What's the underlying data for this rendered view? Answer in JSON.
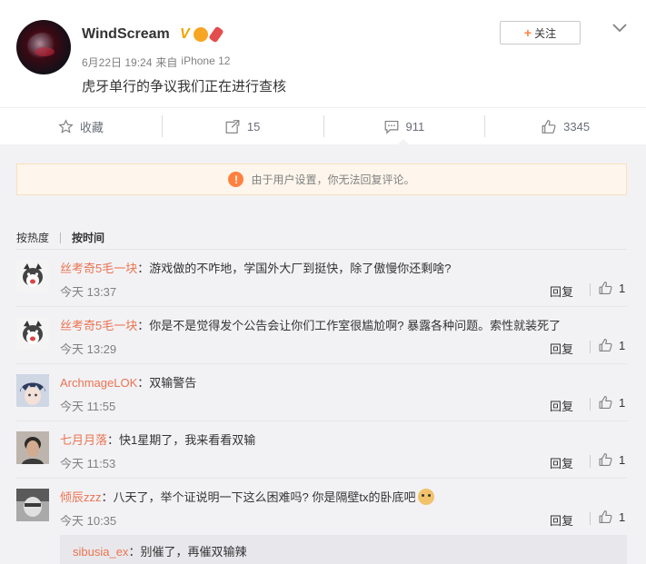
{
  "post": {
    "author": "WindScream",
    "verified_mark": "V",
    "timestamp": "6月22日 19:24",
    "source_prefix": "来自",
    "source_device": "iPhone 12",
    "content": "虎牙单行的争议我们正在进行查核",
    "follow_plus": "+",
    "follow_label": "关注"
  },
  "actions": {
    "favorite_label": "收藏",
    "repost_count": "15",
    "comment_count": "911",
    "like_count": "3345"
  },
  "notice": {
    "icon": "!",
    "text": "由于用户设置，你无法回复评论。"
  },
  "sort": {
    "by_hot": "按热度",
    "by_time": "按时间"
  },
  "comments": [
    {
      "user": "丝考奇5毛一块",
      "sep": "：",
      "text": "游戏做的不咋地，学国外大厂到挺快，除了傲慢你还剩啥?",
      "time": "今天 13:37",
      "reply": "回复",
      "likes": "1",
      "avatar": "husky"
    },
    {
      "user": "丝考奇5毛一块",
      "sep": "：",
      "text": "你是不是觉得发个公告会让你们工作室很尴尬啊? 暴露各种问题。索性就装死了",
      "time": "今天 13:29",
      "reply": "回复",
      "likes": "1",
      "avatar": "husky"
    },
    {
      "user": "ArchmageLOK",
      "sep": "：",
      "text": "双输警告",
      "time": "今天 11:55",
      "reply": "回复",
      "likes": "1",
      "avatar": "anime"
    },
    {
      "user": "七月月落",
      "sep": "：",
      "text": "快1星期了，我来看看双输",
      "time": "今天 11:53",
      "reply": "回复",
      "likes": "1",
      "avatar": "man"
    },
    {
      "user": "倾辰zzz",
      "sep": "：",
      "text": "八天了，举个证说明一下这么困难吗? 你是隔壁tx的卧底吧",
      "time": "今天 10:35",
      "reply": "回复",
      "likes": "1",
      "avatar": "gray"
    }
  ],
  "sub_reply": {
    "user": "sibusia_ex",
    "sep": "：",
    "text": "别催了，再催双输辣"
  },
  "colors": {
    "username": "#eb7350",
    "accent": "#ff8140",
    "background": "#f2f2f5"
  }
}
